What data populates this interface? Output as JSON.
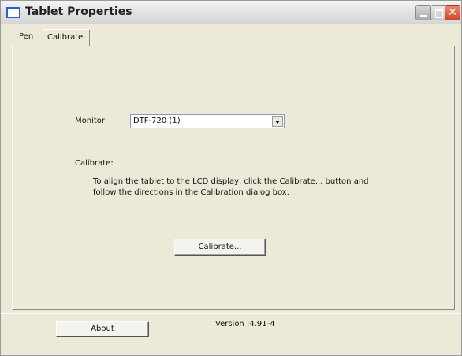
{
  "window": {
    "title": "Tablet Properties",
    "close_glyph": "✕"
  },
  "tabs": [
    {
      "label": "Pen",
      "selected": false
    },
    {
      "label": "Calibrate",
      "selected": true
    }
  ],
  "calibrate_tab": {
    "monitor_label": "Monitor:",
    "monitor_value": "DTF-720 (1)",
    "calibrate_label": "Calibrate:",
    "description_line1": "To align the tablet to the LCD display, click the Calibrate... button and",
    "description_line2": "follow the directions in the Calibration dialog box.",
    "calibrate_button_label": "Calibrate..."
  },
  "footer": {
    "about_button_label": "About",
    "version_text": "Version :4.91-4"
  },
  "colors": {
    "accent_icon": "#2b5fcf",
    "close_button": "#d2452b",
    "dialog_background": "#ece9d8"
  }
}
